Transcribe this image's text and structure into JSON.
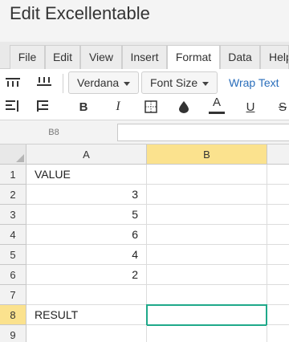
{
  "app": {
    "title": "Edit Excellentable"
  },
  "menu": {
    "items": [
      {
        "label": "File",
        "active": false
      },
      {
        "label": "Edit",
        "active": false
      },
      {
        "label": "View",
        "active": false
      },
      {
        "label": "Insert",
        "active": false
      },
      {
        "label": "Format",
        "active": true
      },
      {
        "label": "Data",
        "active": false
      },
      {
        "label": "Help",
        "active": false
      }
    ]
  },
  "toolbar": {
    "font_family": "Verdana",
    "font_size": "Font Size",
    "wrap_text": "Wrap Text",
    "bold": "B",
    "italic": "I",
    "text_color": "A",
    "underline": "U",
    "strikethrough": "S",
    "icons": [
      "align-top-icon",
      "align-middle-icon",
      "align-bottom-icon",
      "valign-icon",
      "borders-icon",
      "fill-color-icon"
    ]
  },
  "formula_bar": {
    "cell_reference": "B8",
    "value": ""
  },
  "sheet": {
    "columns": [
      "A",
      "B"
    ],
    "selected_column": "B",
    "selected_row": "8",
    "rows": [
      {
        "num": "1",
        "a": "VALUE",
        "a_type": "text",
        "b": ""
      },
      {
        "num": "2",
        "a": "3",
        "a_type": "num",
        "b": ""
      },
      {
        "num": "3",
        "a": "5",
        "a_type": "num",
        "b": ""
      },
      {
        "num": "4",
        "a": "6",
        "a_type": "num",
        "b": ""
      },
      {
        "num": "5",
        "a": "4",
        "a_type": "num",
        "b": ""
      },
      {
        "num": "6",
        "a": "2",
        "a_type": "num",
        "b": ""
      },
      {
        "num": "7",
        "a": "",
        "a_type": "text",
        "b": ""
      },
      {
        "num": "8",
        "a": "RESULT",
        "a_type": "text",
        "b": ""
      },
      {
        "num": "9",
        "a": "",
        "a_type": "text",
        "b": ""
      }
    ]
  },
  "colors": {
    "accent": "#1fa98a",
    "selected_header": "#fbe28e",
    "link": "#2a6ebb"
  }
}
